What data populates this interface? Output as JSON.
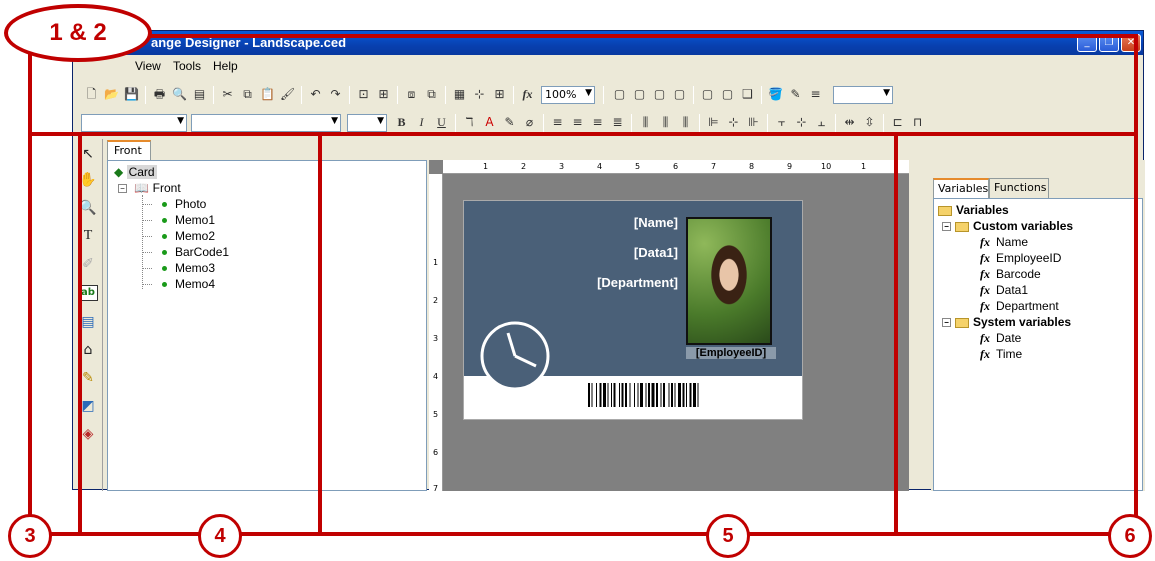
{
  "window": {
    "title": "ange Designer - Landscape.ced",
    "min": "_",
    "max": "❐",
    "close": "✕"
  },
  "menu": [
    "View",
    "Tools",
    "Help"
  ],
  "toolbar": {
    "zoom": "100%"
  },
  "tabs": {
    "front": "Front"
  },
  "tree": {
    "root": "Card",
    "page": "Front",
    "items": [
      "Photo",
      "Memo1",
      "Memo2",
      "BarCode1",
      "Memo3",
      "Memo4"
    ]
  },
  "ruler": {
    "h": [
      "1",
      "2",
      "3",
      "4",
      "5",
      "6",
      "7",
      "8",
      "9",
      "10",
      "1"
    ],
    "v": [
      "1",
      "2",
      "3",
      "4",
      "5",
      "6",
      "7"
    ]
  },
  "card": {
    "name": "[Name]",
    "data1": "[Data1]",
    "department": "[Department]",
    "employee_id": "[EmployeeID]"
  },
  "right_panel": {
    "tab_variables": "Variables",
    "tab_functions": "Functions",
    "root": "Variables",
    "custom": "Custom variables",
    "custom_items": [
      "Name",
      "EmployeeID",
      "Barcode",
      "Data1",
      "Department"
    ],
    "system": "System variables",
    "system_items": [
      "Date",
      "Time"
    ]
  },
  "annotations": {
    "a12": "1 & 2",
    "a3": "3",
    "a4": "4",
    "a5": "5",
    "a6": "6"
  },
  "colors": {
    "annotation": "#c00000",
    "card_band": "#4a6078",
    "titlebar": "#0840b0"
  }
}
